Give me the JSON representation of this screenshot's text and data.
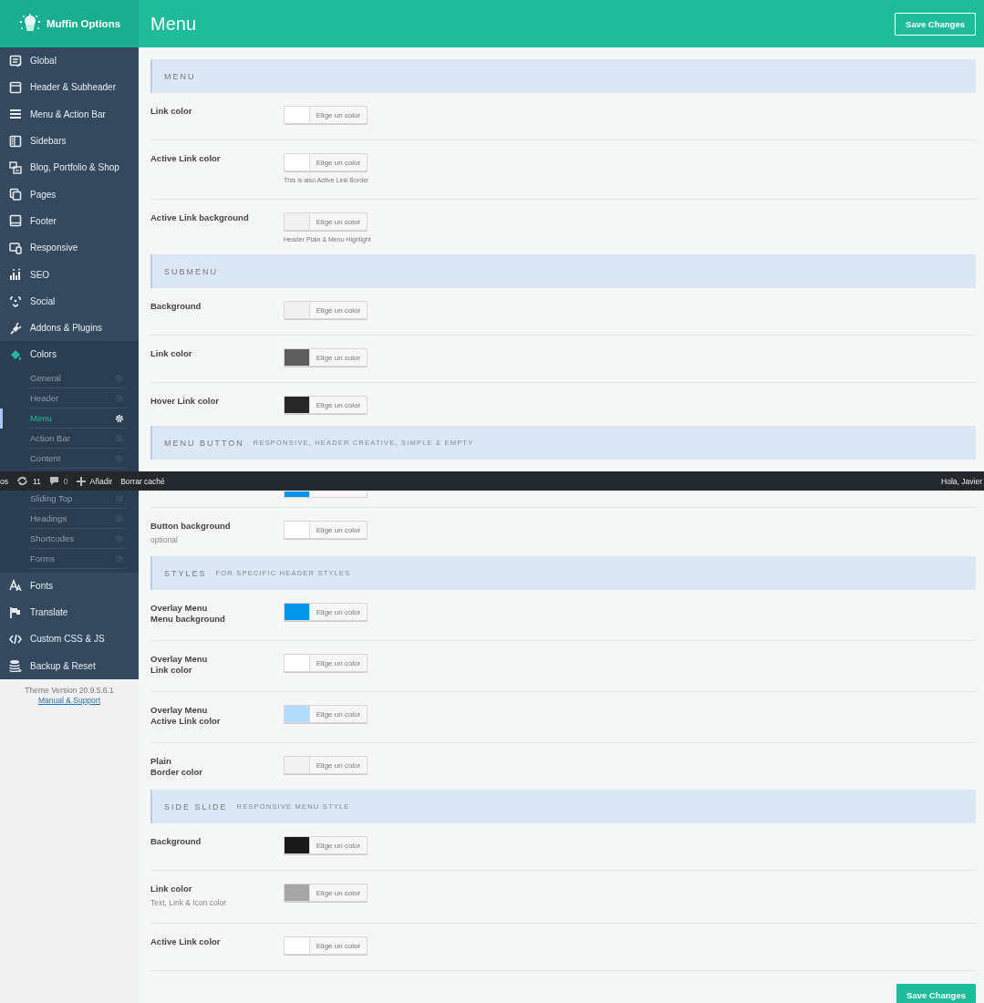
{
  "sidebar": {
    "title": "Muffin Options",
    "items": [
      {
        "label": "Global",
        "expanded": false
      },
      {
        "label": "Header & Subheader",
        "expanded": false
      },
      {
        "label": "Menu & Action Bar",
        "expanded": false
      },
      {
        "label": "Sidebars",
        "expanded": false
      },
      {
        "label": "Blog, Portfolio & Shop",
        "expanded": false
      },
      {
        "label": "Pages",
        "expanded": false
      },
      {
        "label": "Footer",
        "expanded": false
      },
      {
        "label": "Responsive",
        "expanded": false
      },
      {
        "label": "SEO",
        "expanded": false
      },
      {
        "label": "Social",
        "expanded": false
      },
      {
        "label": "Addons & Plugins",
        "expanded": false
      },
      {
        "label": "Colors",
        "expanded": true,
        "children": [
          {
            "label": "General",
            "selected": false
          },
          {
            "label": "Header",
            "selected": false
          },
          {
            "label": "Menu",
            "selected": true
          },
          {
            "label": "Action Bar",
            "selected": false
          },
          {
            "label": "Content",
            "selected": false
          },
          {
            "label": "Sliding Top",
            "selected": false
          },
          {
            "label": "Headings",
            "selected": false
          },
          {
            "label": "Shortcodes",
            "selected": false
          },
          {
            "label": "Forms",
            "selected": false
          }
        ]
      },
      {
        "label": "Fonts",
        "expanded": false
      },
      {
        "label": "Translate",
        "expanded": false
      },
      {
        "label": "Custom CSS & JS",
        "expanded": false
      },
      {
        "label": "Backup & Reset",
        "expanded": false
      }
    ],
    "version": "Theme Version 20.9.5.6.1",
    "support_link": "Manual & Support"
  },
  "header": {
    "title": "Menu",
    "save_button": "Save Changes"
  },
  "sections": [
    {
      "title": "MENU",
      "rows": [
        {
          "kind": "field",
          "label": [
            "Link color"
          ],
          "color": "#ffffff",
          "button": "Elige un color"
        },
        {
          "kind": "field",
          "label": [
            "Active Link color"
          ],
          "color": "#ffffff",
          "button": "Elige un color",
          "note": "This is also Active Link Border"
        },
        {
          "kind": "field",
          "label": [
            "Active Link background"
          ],
          "color": "#f0f0f0",
          "button": "Elige un color",
          "note": "Header Plain & Menu Highlight"
        }
      ]
    },
    {
      "title": "SUBMENU",
      "rows": [
        {
          "kind": "field",
          "label": [
            "Background"
          ],
          "color": "#f0f0f0",
          "button": "Elige un color"
        },
        {
          "kind": "field",
          "label": [
            "Link color"
          ],
          "color": "#5f5f5f",
          "button": "Elige un color"
        },
        {
          "kind": "field",
          "label": [
            "Hover Link color"
          ],
          "color": "#282828",
          "button": "Elige un color"
        }
      ]
    },
    {
      "title": "MENU BUTTON",
      "subtitle": "RESPONSIVE, HEADER CREATIVE, SIMPLE & EMPTY",
      "rows": [
        {
          "kind": "covered",
          "color": "#0095eb"
        },
        {
          "kind": "field",
          "label": [
            "Button background"
          ],
          "hint": "optional",
          "color": "#ffffff",
          "button": "Elige un color"
        }
      ]
    },
    {
      "title": "STYLES",
      "subtitle": "FOR SPECIFIC HEADER STYLES",
      "rows": [
        {
          "kind": "field",
          "label": [
            "Overlay Menu",
            "Menu background"
          ],
          "color": "#0095eb",
          "button": "Elige un color"
        },
        {
          "kind": "field",
          "label": [
            "Overlay Menu",
            "Link color"
          ],
          "color": "#ffffff",
          "button": "Elige un color"
        },
        {
          "kind": "field",
          "label": [
            "Overlay Menu",
            "Active Link color"
          ],
          "color": "#b1dcfb",
          "button": "Elige un color"
        },
        {
          "kind": "field",
          "label": [
            "Plain",
            "Border color"
          ],
          "color": "#f2f2f2",
          "button": "Elige un color"
        }
      ]
    },
    {
      "title": "SIDE SLIDE",
      "subtitle": "RESPONSIVE MENU STYLE",
      "rows": [
        {
          "kind": "field",
          "label": [
            "Background"
          ],
          "color": "#191919",
          "button": "Elige un color"
        },
        {
          "kind": "field",
          "label": [
            "Link color"
          ],
          "hint": "Text, Link & Icon color",
          "color": "#a6a6a6",
          "button": "Elige un color"
        },
        {
          "kind": "field",
          "label": [
            "Active Link color"
          ],
          "color": "#ffffff",
          "button": "Elige un color"
        }
      ]
    }
  ],
  "footer_button": "Save Changes",
  "admin_bar": {
    "items": [
      {
        "kind": "text",
        "label": "os"
      },
      {
        "kind": "updates",
        "count": "11"
      },
      {
        "kind": "comments",
        "count": "0"
      },
      {
        "kind": "new",
        "label": "Añadir"
      },
      {
        "kind": "text",
        "label": "Borrar caché"
      }
    ],
    "greeting": "Hola, Javier"
  }
}
